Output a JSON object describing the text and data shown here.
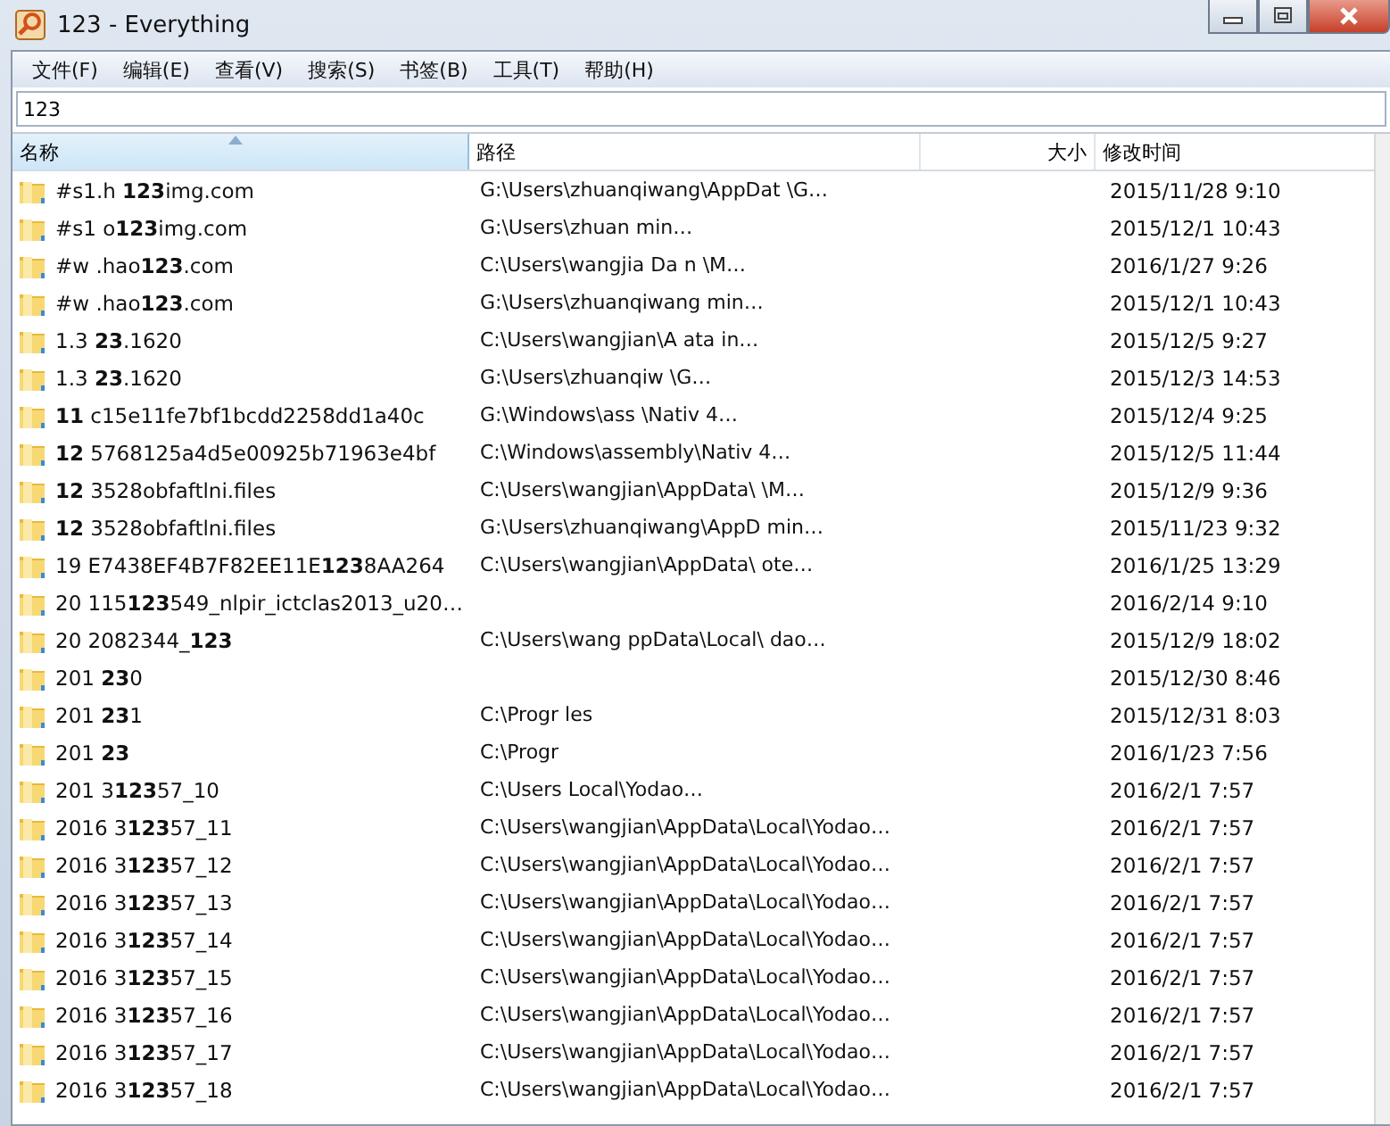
{
  "window": {
    "title": "123 - Everything"
  },
  "menu": [
    "文件(F)",
    "编辑(E)",
    "查看(V)",
    "搜索(S)",
    "书签(B)",
    "工具(T)",
    "帮助(H)"
  ],
  "search": {
    "value": "123"
  },
  "table": {
    "columns": [
      {
        "label": "名称",
        "sorted": true
      },
      {
        "label": "路径",
        "sorted": false
      },
      {
        "label": "大小",
        "sorted": false
      },
      {
        "label": "修改时间",
        "sorted": false
      }
    ],
    "rows": [
      {
        "name": "#s1.h **123**img.com",
        "path": "G:\\Users\\zhuanqiwang\\AppDat \\G…",
        "modified": "2015/11/28 9:10"
      },
      {
        "name": "#s1 o**123**img.com",
        "path": "G:\\Users\\zhuan min…",
        "modified": "2015/12/1 10:43"
      },
      {
        "name": "#w .hao**123**.com",
        "path": "C:\\Users\\wangjia Da n \\M…",
        "modified": "2016/1/27 9:26"
      },
      {
        "name": "#w .hao**123**.com",
        "path": "G:\\Users\\zhuanqiwang min…",
        "modified": "2015/12/1 10:43"
      },
      {
        "name": "1.3 **23**.1620",
        "path": "C:\\Users\\wangjian\\A ata in…",
        "modified": "2015/12/5 9:27"
      },
      {
        "name": "1.3 **23**.1620",
        "path": "G:\\Users\\zhuanqiw \\G…",
        "modified": "2015/12/3 14:53"
      },
      {
        "name": "**11** c15e11fe7bf1bcdd2258dd1a40c",
        "path": "G:\\Windows\\ass \\Nativ 4…",
        "modified": "2015/12/4 9:25"
      },
      {
        "name": "**12** 5768125a4d5e00925b71963e4bf",
        "path": "C:\\Windows\\assembly\\Nativ 4…",
        "modified": "2015/12/5 11:44"
      },
      {
        "name": "**12** 3528obfaftlni.files",
        "path": "C:\\Users\\wangjian\\AppData\\ \\M…",
        "modified": "2015/12/9 9:36"
      },
      {
        "name": "**12** 3528obfaftlni.files",
        "path": "G:\\Users\\zhuanqiwang\\AppD min…",
        "modified": "2015/11/23 9:32"
      },
      {
        "name": "19 E7438EF4B7F82EE11E**123**8AA264",
        "path": "C:\\Users\\wangjian\\AppData\\ ote…",
        "modified": "2016/1/25 13:29"
      },
      {
        "name": "20 115**123**549_nlpir_ictclas2013_u20…",
        "modified": "2016/2/14 9:10"
      },
      {
        "name": "20 2082344_**123**",
        "path": "C:\\Users\\wang ppData\\Local\\ dao…",
        "modified": "2015/12/9 18:02"
      },
      {
        "name": "201 **23**0",
        "modified": "2015/12/30 8:46"
      },
      {
        "name": "201 **23**1",
        "path": "C:\\Progr les",
        "modified": "2015/12/31 8:03"
      },
      {
        "name": "201 **23**",
        "path": "C:\\Progr",
        "modified": "2016/1/23 7:56"
      },
      {
        "name": "201 3**123**57_10",
        "path": "C:\\Users Local\\Yodao…",
        "modified": "2016/2/1 7:57"
      },
      {
        "name": "2016 3**123**57_11",
        "path": "C:\\Users\\wangjian\\AppData\\Local\\Yodao…",
        "modified": "2016/2/1 7:57"
      },
      {
        "name": "2016 3**123**57_12",
        "path": "C:\\Users\\wangjian\\AppData\\Local\\Yodao…",
        "modified": "2016/2/1 7:57"
      },
      {
        "name": "2016 3**123**57_13",
        "path": "C:\\Users\\wangjian\\AppData\\Local\\Yodao…",
        "modified": "2016/2/1 7:57"
      },
      {
        "name": "2016 3**123**57_14",
        "path": "C:\\Users\\wangjian\\AppData\\Local\\Yodao…",
        "modified": "2016/2/1 7:57"
      },
      {
        "name": "2016 3**123**57_15",
        "path": "C:\\Users\\wangjian\\AppData\\Local\\Yodao…",
        "modified": "2016/2/1 7:57"
      },
      {
        "name": "2016 3**123**57_16",
        "path": "C:\\Users\\wangjian\\AppData\\Local\\Yodao…",
        "modified": "2016/2/1 7:57"
      },
      {
        "name": "2016 3**123**57_17",
        "path": "C:\\Users\\wangjian\\AppData\\Local\\Yodao…",
        "modified": "2016/2/1 7:57"
      },
      {
        "name": "2016 3**123**57_18",
        "path": "C:\\Users\\wangjian\\AppData\\Local\\Yodao…",
        "modified": "2016/2/1 7:57"
      }
    ]
  }
}
